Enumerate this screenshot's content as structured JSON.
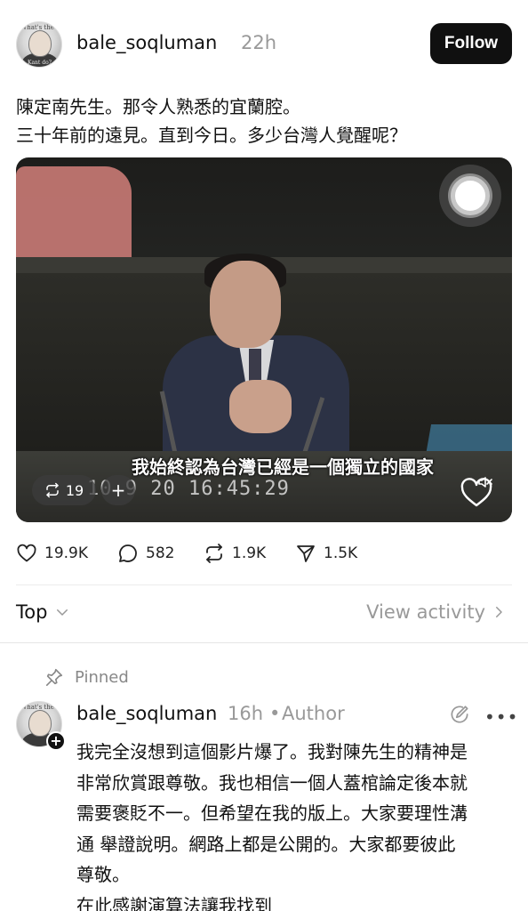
{
  "post": {
    "username": "bale_soqluman",
    "time": "22h",
    "follow_label": "Follow",
    "avatar_caption_top": "What's the first",
    "avatar_caption_bottom": "Kant do?",
    "text_lines": [
      "陳定南先生。那令人熟悉的宜蘭腔。",
      "三十年前的遠見。直到今日。多少台灣人覺醒呢？"
    ]
  },
  "video": {
    "subtitle": "我始終認為台灣已經是一個獨立的國家",
    "timecode": "10 9 20 16:45:29",
    "repost_count": "19",
    "add_label": "+",
    "icons": {
      "repost": "repost-icon",
      "mute": "speaker-muted-icon",
      "record": "record-ring-icon"
    }
  },
  "actions": {
    "likes": "19.9K",
    "comments": "582",
    "reposts": "1.9K",
    "shares": "1.5K"
  },
  "sort": {
    "label": "Top",
    "view_activity": "View activity"
  },
  "pinned_label": "Pinned",
  "reply": {
    "username": "bale_soqluman",
    "time": "16h",
    "separator": "•",
    "badge": "Author",
    "more": "•••",
    "lines": [
      "我完全沒想到這個影片爆了。我對陳先生的精神是",
      "非常欣賞跟尊敬。我也相信一個人蓋棺論定後本就",
      "需要褒貶不一。但希望在我的版上。大家要理性溝",
      "通 舉證說明。網路上都是公開的。大家都要彼此",
      "尊敬。",
      "在此感謝演算法讓我找到"
    ]
  },
  "colors": {
    "follow_bg": "#101010",
    "muted_text": "#999999",
    "text": "#111111"
  }
}
